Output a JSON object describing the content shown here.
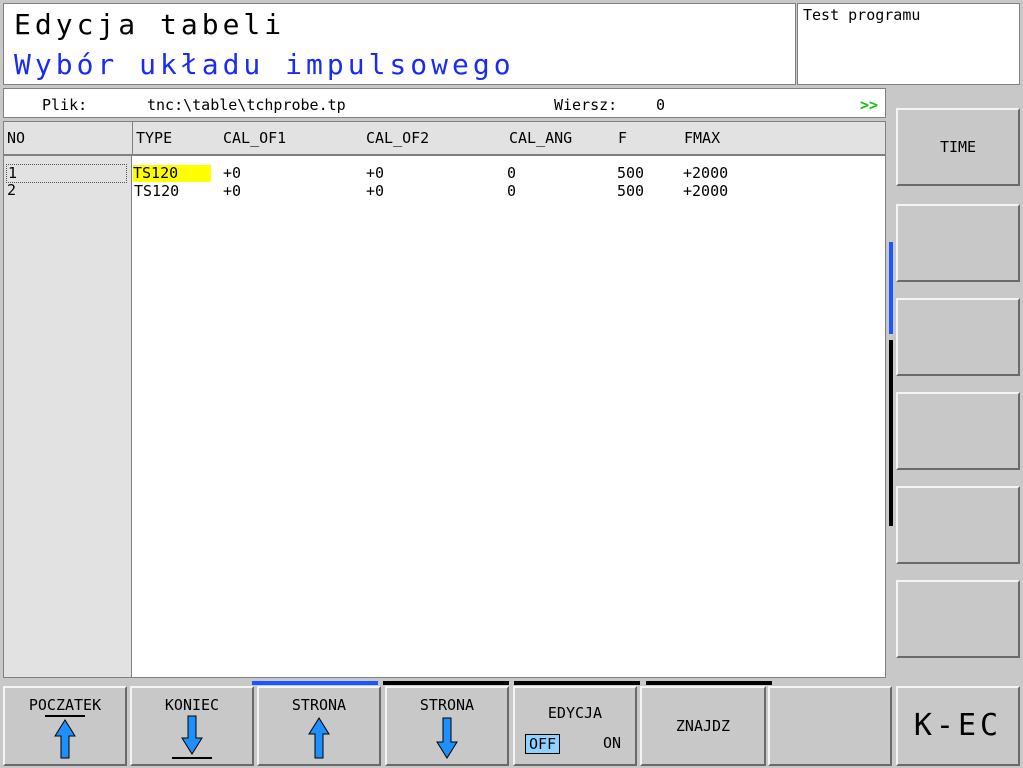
{
  "header": {
    "title": "Edycja tabeli",
    "subtitle": "Wybór układu impulsowego",
    "mode": "Test programu"
  },
  "info": {
    "file_label": "Plik:",
    "file_path": "tnc:\\table\\tchprobe.tp",
    "row_label": "Wiersz:",
    "row_value": "0",
    "more": ">>"
  },
  "table": {
    "columns": [
      "NO",
      "TYPE",
      "CAL_OF1",
      "CAL_OF2",
      "CAL_ANG",
      "F",
      "FMAX"
    ],
    "rows": [
      {
        "no": "1",
        "type": "TS120",
        "cal_of1": "+0",
        "cal_of2": "+0",
        "cal_ang": "0",
        "f": "500",
        "fmax": "+2000"
      },
      {
        "no": "2",
        "type": "TS120",
        "cal_of1": "+0",
        "cal_of2": "+0",
        "cal_ang": "0",
        "f": "500",
        "fmax": "+2000"
      }
    ]
  },
  "side_keys": {
    "time": "TIME"
  },
  "softkeys": {
    "poczatek": "POCZATEK",
    "koniec": "KONIEC",
    "strona_up": "STRONA",
    "strona_down": "STRONA",
    "edycja": "EDYCJA",
    "off": "OFF",
    "on": "ON",
    "znajdz": "ZNAJDZ",
    "kec": "K-EC"
  },
  "colors": {
    "subtitle": "#1a2cf0",
    "selection": "#ffff00",
    "more_arrow": "#16c016",
    "icon_blue": "#1e8fff",
    "off_tag": "#8fd1ff"
  }
}
